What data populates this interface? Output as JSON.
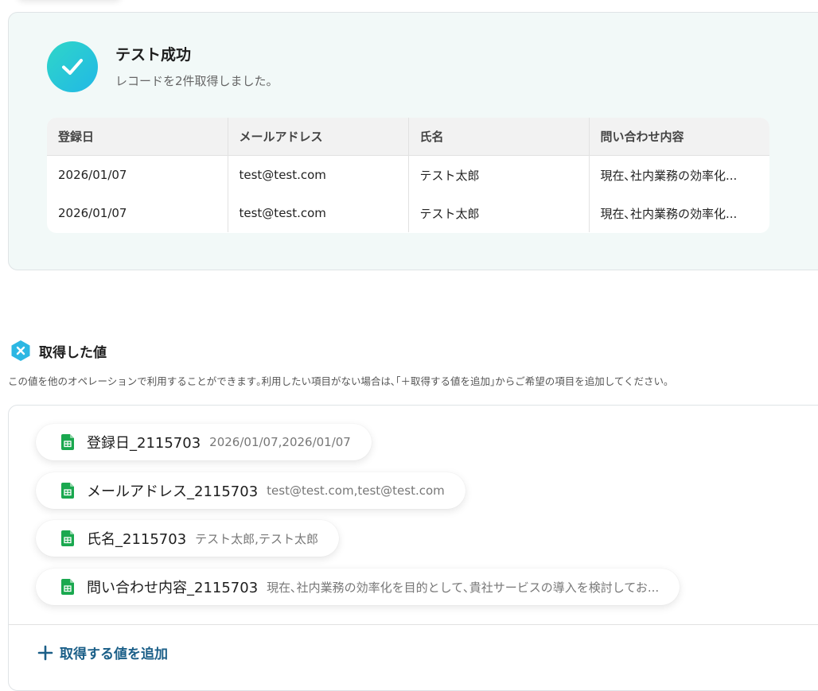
{
  "success": {
    "title": "テスト成功",
    "subtitle": "レコードを2件取得しました。"
  },
  "result_table": {
    "columns": [
      "登録日",
      "メールアドレス",
      "氏名",
      "問い合わせ内容"
    ],
    "rows": [
      [
        "2026/01/07",
        "test@test.com",
        "テスト太郎",
        "現在､社内業務の効率化..."
      ],
      [
        "2026/01/07",
        "test@test.com",
        "テスト太郎",
        "現在､社内業務の効率化..."
      ]
    ]
  },
  "acquired": {
    "title": "取得した値",
    "description": "この値を他のオペレーションで利用することができます｡利用したい項目がない場合は､｢＋取得する値を追加｣からご希望の項目を追加してください｡",
    "items": [
      {
        "label": "登録日_2115703",
        "value": "2026/01/07,2026/01/07"
      },
      {
        "label": "メールアドレス_2115703",
        "value": "test@test.com,test@test.com"
      },
      {
        "label": "氏名_2115703",
        "value": "テスト太郎,テスト太郎"
      },
      {
        "label": "問い合わせ内容_2115703",
        "value": "現在､社内業務の効率化を目的として､貴社サービスの導入を検討してお..."
      }
    ],
    "add_label": "取得する値を追加"
  },
  "colors": {
    "success_gradient_start": "#2fd6c8",
    "success_gradient_end": "#21b8e6",
    "sheets_green": "#1aa84f",
    "add_link": "#1b5f88",
    "card_bg": "#f2f9f8"
  },
  "icons": {
    "success": "check-icon",
    "acquired": "variable-badge-icon",
    "item": "google-sheets-icon",
    "add": "plus-icon"
  }
}
